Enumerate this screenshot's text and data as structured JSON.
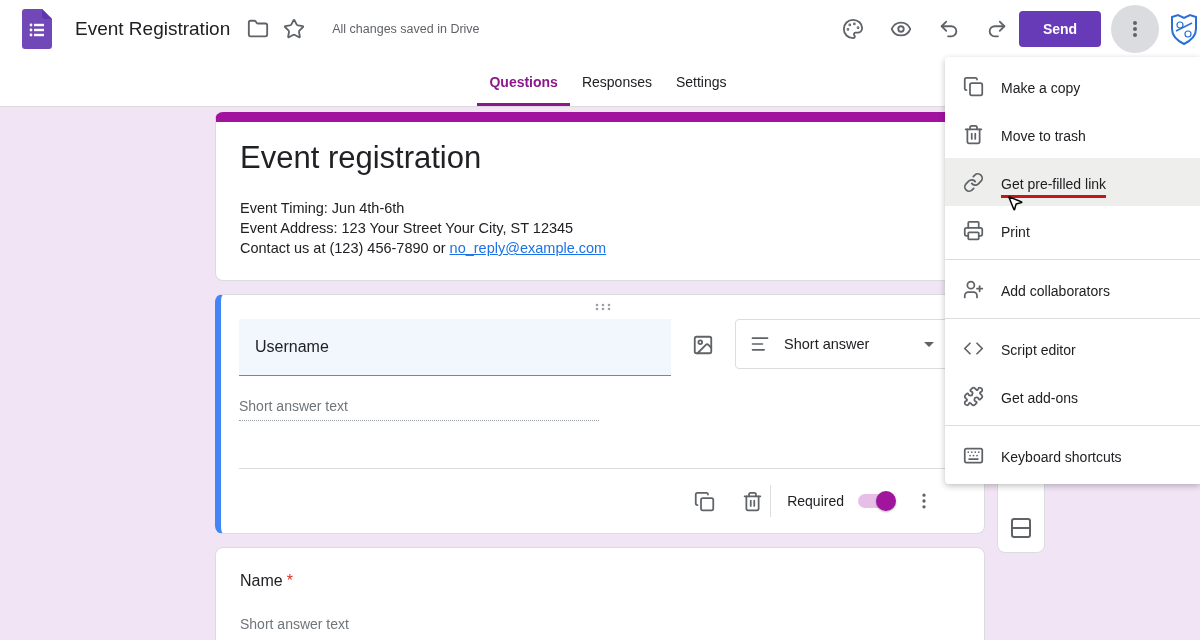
{
  "header": {
    "title": "Event Registration",
    "save_status": "All changes saved in Drive",
    "send_button": "Send"
  },
  "tabs": [
    {
      "label": "Questions",
      "selected": true
    },
    {
      "label": "Responses",
      "selected": false
    },
    {
      "label": "Settings",
      "selected": false
    }
  ],
  "form_header": {
    "title": "Event registration",
    "description": [
      "Event Timing: Jun 4th-6th",
      "Event Address: 123 Your Street Your City, ST 12345"
    ],
    "contact": {
      "text": "Contact us at (123) 456-7890 or ",
      "link": "no_reply@example.com"
    }
  },
  "questions": [
    {
      "title": "Username",
      "active": true,
      "type": "Short answer",
      "placeholder": "Short answer text",
      "required_label": "Required",
      "required": true
    },
    {
      "title": "Name",
      "active": false,
      "required_mark": "*",
      "placeholder": "Short answer text"
    }
  ],
  "menu": [
    [
      {
        "kind": "copy",
        "label": "Make a copy",
        "selected": false,
        "underlined": false
      },
      {
        "kind": "trash",
        "label": "Move to trash",
        "selected": false,
        "underlined": false
      },
      {
        "kind": "link",
        "label": "Get pre-filled link",
        "selected": true,
        "underlined": true
      },
      {
        "kind": "print",
        "label": "Print",
        "selected": false,
        "underlined": false
      }
    ],
    [
      {
        "kind": "collaborators",
        "label": "Add collaborators",
        "selected": false,
        "underlined": false
      }
    ],
    [
      {
        "kind": "script",
        "label": "Script editor",
        "selected": false,
        "underlined": false
      },
      {
        "kind": "addons",
        "label": "Get add-ons",
        "selected": false,
        "underlined": false
      }
    ],
    [
      {
        "kind": "keyboard",
        "label": "Keyboard shortcuts",
        "selected": false,
        "underlined": false
      }
    ]
  ]
}
